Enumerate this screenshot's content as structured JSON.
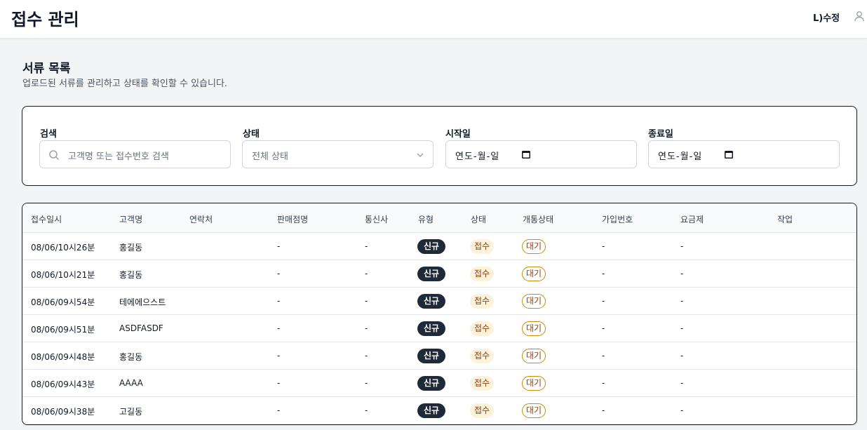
{
  "header": {
    "title": "접수 관리",
    "user_name": "L)수정"
  },
  "page": {
    "section_title": "서류 목록",
    "section_desc": "업로드된 서류를 관리하고 상태를 확인할 수 있습니다."
  },
  "filters": {
    "search_label": "검색",
    "search_placeholder": "고객명 또는 접수번호 검색",
    "status_label": "상태",
    "status_value": "전체 상태",
    "start_label": "시작일",
    "start_value": "연도-월-일",
    "end_label": "종료일",
    "end_value": "연도-월-일"
  },
  "table": {
    "columns": [
      "접수일시",
      "고객명",
      "연락처",
      "판매점명",
      "통신사",
      "유형",
      "상태",
      "개통상태",
      "가입번호",
      "요금제",
      "작업"
    ],
    "rows": [
      {
        "date": "08/06/10시26분",
        "customer": "홍길동",
        "contact": "",
        "store": "-",
        "carrier": "-",
        "type": "신규",
        "status": "접수",
        "open_status": "대기",
        "join_no": "-",
        "plan": "-",
        "action": ""
      },
      {
        "date": "08/06/10시21분",
        "customer": "홍길동",
        "contact": "",
        "store": "-",
        "carrier": "-",
        "type": "신규",
        "status": "접수",
        "open_status": "대기",
        "join_no": "-",
        "plan": "-",
        "action": ""
      },
      {
        "date": "08/06/09시54분",
        "customer": "테에에으스트",
        "contact": "",
        "store": "-",
        "carrier": "-",
        "type": "신규",
        "status": "접수",
        "open_status": "대기",
        "join_no": "-",
        "plan": "-",
        "action": ""
      },
      {
        "date": "08/06/09시51분",
        "customer": "ASDFASDF",
        "contact": "",
        "store": "-",
        "carrier": "-",
        "type": "신규",
        "status": "접수",
        "open_status": "대기",
        "join_no": "-",
        "plan": "-",
        "action": ""
      },
      {
        "date": "08/06/09시48분",
        "customer": "홍길동",
        "contact": "",
        "store": "-",
        "carrier": "-",
        "type": "신규",
        "status": "접수",
        "open_status": "대기",
        "join_no": "-",
        "plan": "-",
        "action": ""
      },
      {
        "date": "08/06/09시43분",
        "customer": "AAAA",
        "contact": "",
        "store": "-",
        "carrier": "-",
        "type": "신규",
        "status": "접수",
        "open_status": "대기",
        "join_no": "-",
        "plan": "-",
        "action": ""
      },
      {
        "date": "08/06/09시38분",
        "customer": "고길동",
        "contact": "",
        "store": "-",
        "carrier": "-",
        "type": "신규",
        "status": "접수",
        "open_status": "대기",
        "join_no": "-",
        "plan": "-",
        "action": ""
      }
    ]
  }
}
